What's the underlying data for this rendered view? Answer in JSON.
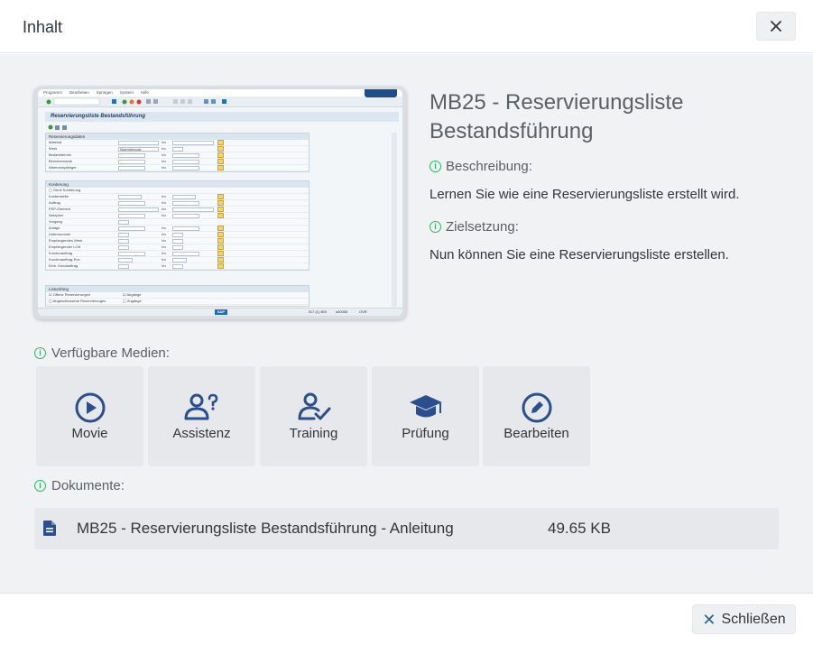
{
  "dialog": {
    "title": "Inhalt",
    "close_button_label": "Schließen"
  },
  "content": {
    "title": "MB25 - Reservierungsliste Bestandsführung",
    "description_label": "Beschreibung:",
    "description": "Lernen Sie wie eine Reservierungsliste erstellt wird.",
    "goal_label": "Zielsetzung:",
    "goal": "Nun können Sie eine Reservierungsliste erstellen."
  },
  "thumbnail": {
    "menu": [
      "Programm",
      "Bearbeiten",
      "Springen",
      "System",
      "Hilfe"
    ],
    "screen_title": "Reservierungsliste Bestandsführung",
    "groups": [
      {
        "title": "Reservierungsdaten",
        "rows": [
          "Material",
          "Werk",
          "Bedarfstermin",
          "Benutzername",
          "Warenempfänger"
        ]
      },
      {
        "title": "Kontierung",
        "rows": [
          "Ohne Kontierung",
          "Kostenstelle",
          "Auftrag",
          "PSP-Element",
          "Netzplan",
          "Vorgang",
          "Anlage",
          "Unternummer",
          "Empfangendes Werk",
          "Empfangender LOrt",
          "Kundenauftrag",
          "Kundenauftrag-Pos",
          "Einh. Kundauftrag"
        ]
      },
      {
        "title": "Listumfang",
        "rows": [
          "Offene Reservierungen",
          "Abgeschlossene Reservierungen"
        ]
      }
    ],
    "werk_value": "Materialeinsatz",
    "bis_label": "bis",
    "check_labels": [
      "Abgänge",
      "Zugänge"
    ],
    "status_text": "ID7 (1) 800",
    "status_user": "s00065",
    "status_mode": "OVR",
    "sap_logo": "SAP"
  },
  "media": {
    "label": "Verfügbare Medien:",
    "items": [
      {
        "label": "Movie",
        "icon": "play-circle-icon"
      },
      {
        "label": "Assistenz",
        "icon": "user-question-icon"
      },
      {
        "label": "Training",
        "icon": "user-check-icon"
      },
      {
        "label": "Prüfung",
        "icon": "graduation-cap-icon"
      },
      {
        "label": "Bearbeiten",
        "icon": "edit-pencil-icon"
      }
    ]
  },
  "documents": {
    "label": "Dokumente:",
    "items": [
      {
        "name": "MB25 - Reservierungsliste Bestandsführung - Anleitung",
        "size": "49.65 KB",
        "icon": "document-icon"
      }
    ]
  },
  "colors": {
    "accent": "#2b5e9c",
    "info": "#2fb36b",
    "tile": "#e6e8ec",
    "background": "#f0f2f4"
  }
}
